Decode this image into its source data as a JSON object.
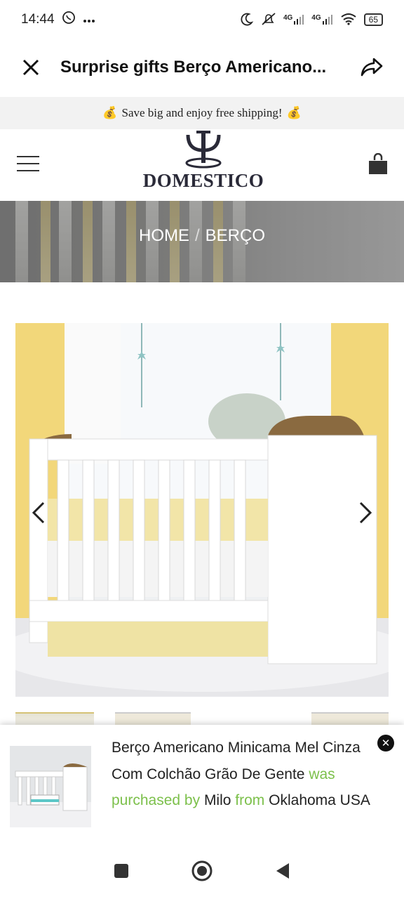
{
  "status_bar": {
    "time": "14:44",
    "left_icons": [
      "whatsapp-icon",
      "more-dots-icon"
    ],
    "right_icons": [
      "moon-icon",
      "mute-icon",
      "signal-4g-icon",
      "signal-4g-icon",
      "wifi-icon",
      "battery-icon"
    ],
    "net1": "4G",
    "net2": "4G",
    "battery": "65"
  },
  "titlebar": {
    "title": "Surprise gifts Berço Americano...",
    "close_icon": "close-icon",
    "share_icon": "share-icon"
  },
  "promo": {
    "emoji": "💰",
    "text": "Save big and enjoy free shipping!"
  },
  "header": {
    "brand": "DOMESTICO",
    "menu_icon": "hamburger-icon",
    "cart_icon": "shopping-bag-icon"
  },
  "breadcrumb": {
    "items": [
      "HOME",
      "BERÇO"
    ],
    "separator": "/"
  },
  "product": {
    "image_desc_icon": "crib-image",
    "prev_icon": "chevron-left-icon",
    "next_icon": "chevron-right-icon"
  },
  "notification": {
    "product_name": "Berço Americano Minicama Mel Cinza Com Colchão Grão De Gente",
    "purchased_text": "was purchased by",
    "buyer": "Milo",
    "from_text": "from",
    "location": "Oklahoma USA",
    "accent_color": "#7cc04b"
  },
  "navbar": {
    "icons": [
      "recents-icon",
      "home-icon",
      "back-icon"
    ]
  }
}
